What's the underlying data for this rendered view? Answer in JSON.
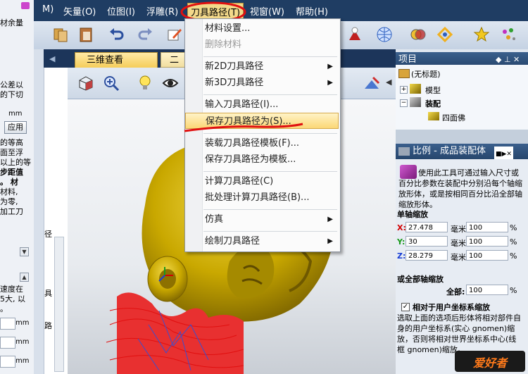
{
  "menubar": {
    "items": [
      "M)",
      "矢量(O)",
      "位图(I)",
      "浮雕(R)",
      "刀具路径(T)",
      "视窗(W)",
      "帮助(H)"
    ]
  },
  "dropdown": {
    "items": [
      {
        "label": "材料设置...",
        "disabled": false,
        "submenu": false
      },
      {
        "label": "删除材料",
        "disabled": true,
        "submenu": false
      },
      {
        "label": "新2D刀具路径",
        "disabled": false,
        "submenu": true
      },
      {
        "label": "新3D刀具路径",
        "disabled": false,
        "submenu": true
      },
      {
        "label": "输入刀具路径(I)...",
        "disabled": false,
        "submenu": false
      },
      {
        "label": "保存刀具路径为(S)...",
        "disabled": false,
        "submenu": false,
        "highlighted": true
      },
      {
        "label": "装载刀具路径模板(F)...",
        "disabled": false,
        "submenu": false
      },
      {
        "label": "保存刀具路径为模板...",
        "disabled": false,
        "submenu": false
      },
      {
        "label": "计算刀具路径(C)",
        "disabled": false,
        "submenu": false
      },
      {
        "label": "批处理计算刀具路径(B)...",
        "disabled": false,
        "submenu": false
      },
      {
        "label": "仿真",
        "disabled": false,
        "submenu": true
      },
      {
        "label": "绘制刀具路径",
        "disabled": false,
        "submenu": true
      }
    ]
  },
  "tabs": {
    "active": "三维查看",
    "second": "二"
  },
  "left_panel": {
    "lines": [
      "材余量",
      "公差以",
      "的下切",
      "mm",
      "的等高",
      "面至浮",
      "以上的等",
      "步距值",
      "。 材",
      "材料,",
      "为零,",
      "加工刀",
      "速度在",
      "5大, 以",
      "。"
    ],
    "apply_button": "应用",
    "side_chars": [
      "径",
      "具",
      "路"
    ],
    "units": [
      "mm",
      "mm",
      "mm"
    ]
  },
  "project": {
    "title": "项目",
    "tree": {
      "root": "(无标题)",
      "model": "模型",
      "assembly": "装配",
      "part": "四面佛"
    }
  },
  "scale_panel": {
    "title": "比例 - 成品装配体",
    "description": "使用此工具可通过输入尺寸或百分比参数在装配中分别沿每个轴缩放形体，或是按相同百分比沿全部轴缩放形体。",
    "single_axis_heading": "单轴缩放",
    "axes": [
      {
        "axis": "X:",
        "value": "27.478",
        "unit": "毫米",
        "percent": "100",
        "color": "#d40000"
      },
      {
        "axis": "Y:",
        "value": "30",
        "unit": "毫米",
        "percent": "100",
        "color": "#1a9a1a"
      },
      {
        "axis": "Z:",
        "value": "28.279",
        "unit": "毫米",
        "percent": "100",
        "color": "#1a3fd4"
      }
    ],
    "percent_sign": "%",
    "all_axis_heading": "或全部轴缩放",
    "all_label": "全部:",
    "all_value": "100",
    "relative_checkbox_label": "相对于用户坐标系缩放",
    "relative_checked": true,
    "relative_text": "选取上面的选项后形体将相对部件自身的用户坐标系(实心 gnomen)缩放，否则将相对世界坐标系中心(线框 gnomen)缩放。"
  },
  "watermark": "爱好者",
  "colors": {
    "menubar_bg": "#1f3d63",
    "highlight": "#fbd776",
    "annotation_red": "#e01010",
    "model_gold": "#c9a800"
  }
}
